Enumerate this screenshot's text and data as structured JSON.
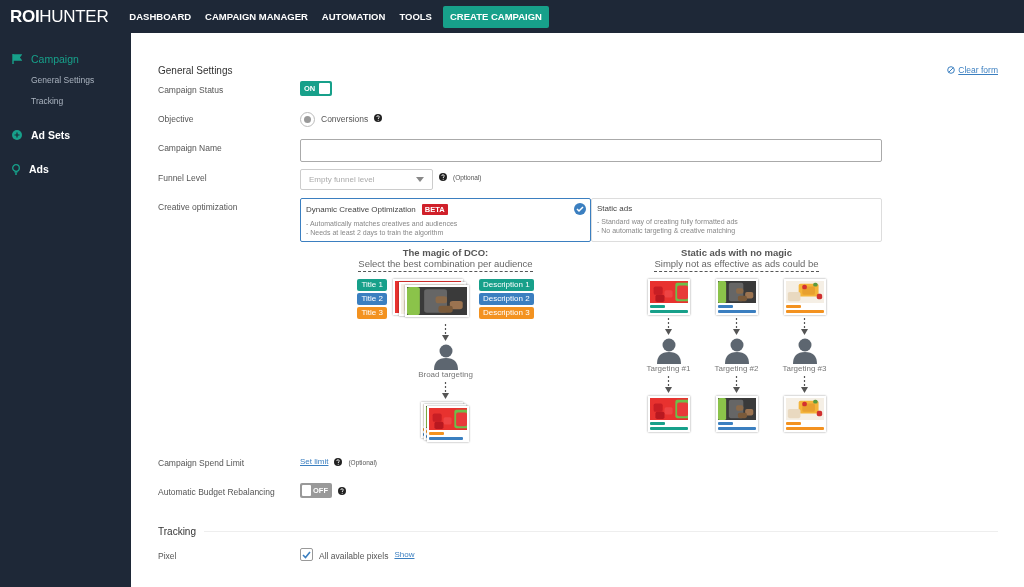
{
  "nav": {
    "logo": {
      "bold": "ROI",
      "light": "HUNTER"
    },
    "items": [
      {
        "label": "DASHBOARD",
        "selected": false
      },
      {
        "label": "CAMPAIGN MANAGER",
        "selected": false
      },
      {
        "label": "AUTOMATION",
        "selected": false
      },
      {
        "label": "TOOLS",
        "selected": false
      },
      {
        "label": "CREATE CAMPAIGN",
        "selected": true
      }
    ]
  },
  "sidebar": {
    "sections": [
      {
        "label": "Campaign",
        "active": true,
        "children": [
          {
            "label": "General Settings"
          },
          {
            "label": "Tracking"
          }
        ]
      },
      {
        "label": "Ad Sets",
        "active": false
      },
      {
        "label": "Ads",
        "active": false
      }
    ]
  },
  "form": {
    "title": "General Settings",
    "clear_link": "Clear form",
    "fields": [
      {
        "kind": "toggle",
        "label": "Campaign Status",
        "on": true,
        "text": "ON"
      },
      {
        "kind": "radio",
        "label": "Objective",
        "option": "Conversions",
        "selected": true,
        "help": true
      },
      {
        "kind": "text",
        "label": "Campaign Name"
      },
      {
        "kind": "select",
        "label": "Funnel Level",
        "placeholder": "Empty funnel level",
        "help": true,
        "note": "(Optional)"
      },
      {
        "kind": "options",
        "label": "Creative optimization",
        "options": [
          {
            "title": "Dynamic Creative Optimization",
            "badge": "BETA",
            "lines": [
              "- Automatically matches creatives and audiences",
              "- Needs at least 2 days to train the algorithm"
            ],
            "selected": true
          },
          {
            "title": "Static ads",
            "lines": [
              "- Standard way of creating fully formatted ads",
              "- No automatic targeting & creative matching"
            ],
            "selected": false
          }
        ]
      },
      {
        "kind": "diagram",
        "dco": {
          "heading": "The magic of DCO:",
          "subheading": "Select the best combination per audience",
          "titles": [
            {
              "label": "Title 1",
              "color": "#17a08a"
            },
            {
              "label": "Title 2",
              "color": "#3b7fc0"
            },
            {
              "label": "Title 3",
              "color": "#f39220"
            }
          ],
          "descriptions": [
            {
              "label": "Description 1",
              "color": "#17a08a"
            },
            {
              "label": "Description 2",
              "color": "#3b7fc0"
            },
            {
              "label": "Description 3",
              "color": "#f39220"
            }
          ],
          "target": "Broad targeting"
        },
        "static": {
          "heading": "Static ads with no magic",
          "subheading": "Simply not as effective as ads could be",
          "targets": [
            {
              "label": "Targeting #1",
              "color": "#17a08a"
            },
            {
              "label": "Targeting #2",
              "color": "#3b7fc0"
            },
            {
              "label": "Targeting #3",
              "color": "#f39220"
            }
          ]
        }
      },
      {
        "kind": "link",
        "label": "Campaign Spend Limit",
        "link": "Set limit",
        "help": true,
        "note": "(Optional)"
      },
      {
        "kind": "toggle",
        "label": "Automatic Budget Rebalancing",
        "on": false,
        "text": "OFF",
        "help": true
      }
    ]
  },
  "tracking": {
    "title": "Tracking",
    "fields": [
      {
        "kind": "checkbox",
        "label": "Pixel",
        "checked": true,
        "text": "All available pixels",
        "link": "Show"
      }
    ]
  }
}
